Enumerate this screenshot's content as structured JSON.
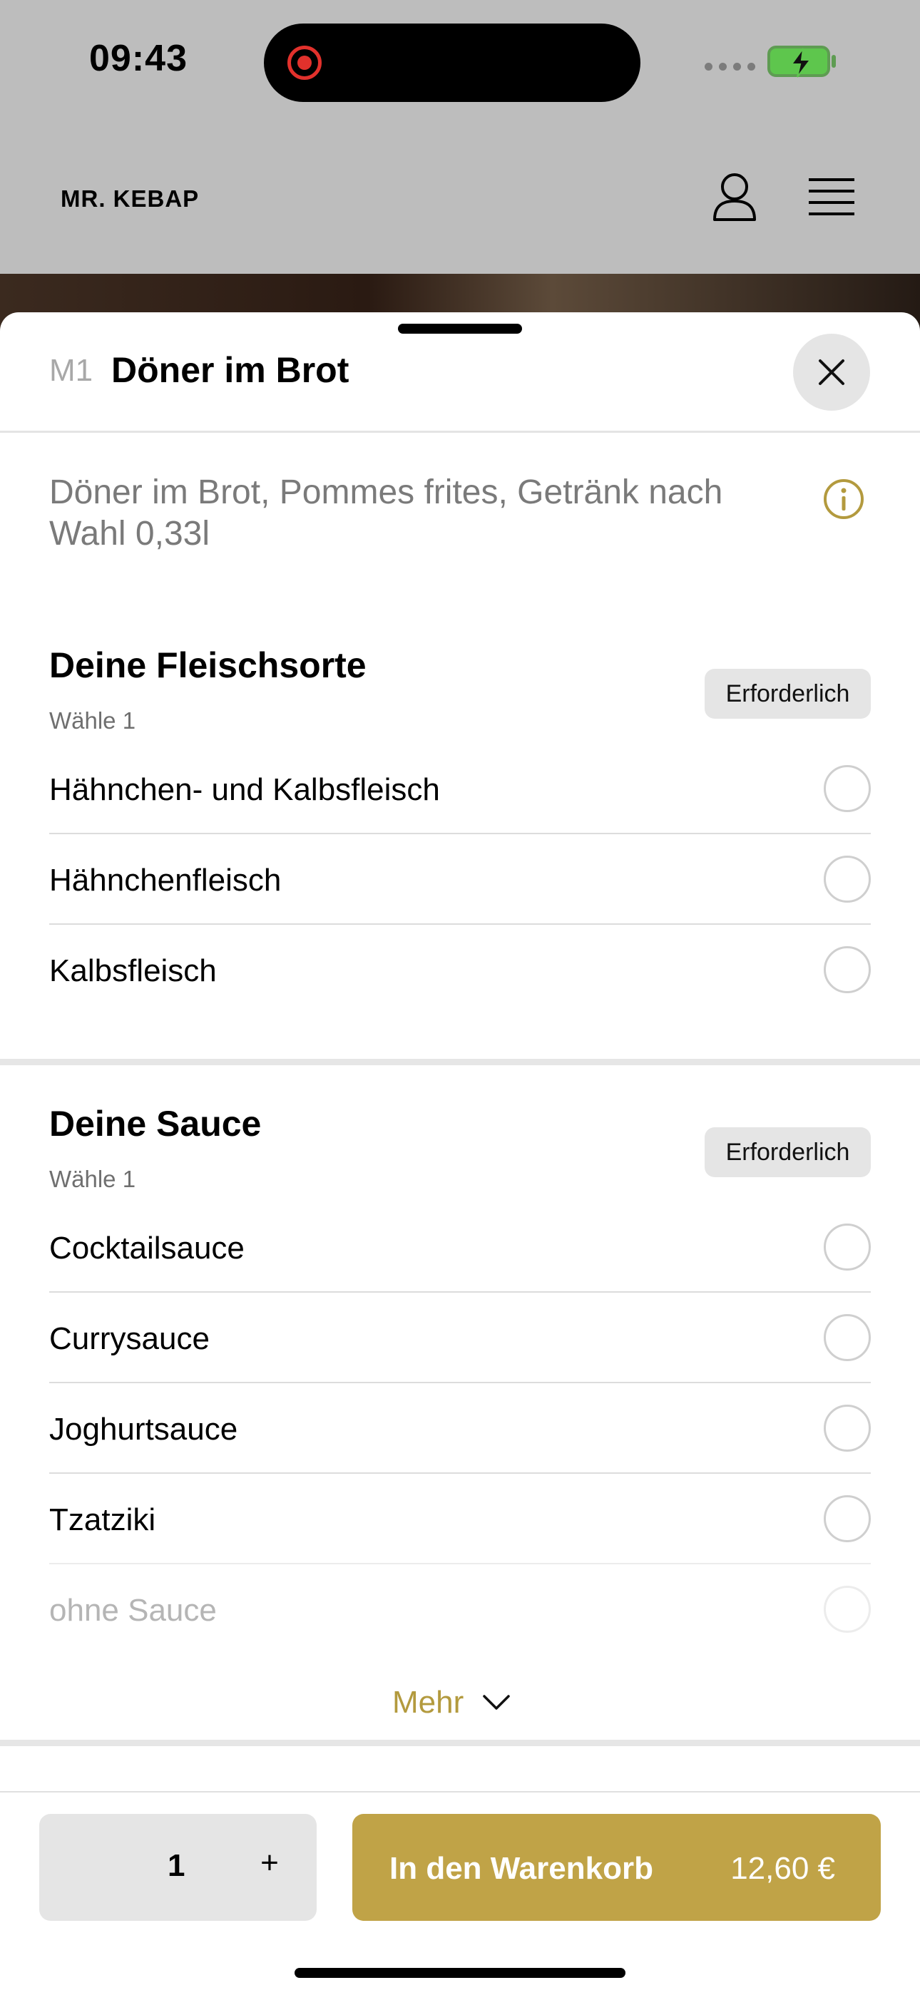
{
  "status_bar": {
    "time": "09:43"
  },
  "header": {
    "brand": "MR. KEBAP"
  },
  "sheet": {
    "code": "M1",
    "title": "Döner im Brot",
    "description": "Döner im Brot, Pommes frites, Getränk nach Wahl 0,33l"
  },
  "groups": [
    {
      "title": "Deine Fleischsorte",
      "subtitle": "Wähle 1",
      "badge": "Erforderlich",
      "options": [
        "Hähnchen- und Kalbsfleisch",
        "Hähnchenfleisch",
        "Kalbsfleisch"
      ]
    },
    {
      "title": "Deine Sauce",
      "subtitle": "Wähle 1",
      "badge": "Erforderlich",
      "options": [
        "Cocktailsauce",
        "Currysauce",
        "Joghurtsauce",
        "Tzatziki",
        "ohne Sauce"
      ]
    }
  ],
  "more_label": "Mehr",
  "footer": {
    "quantity": "1",
    "plus_symbol": "+",
    "cart_label": "In den Warenkorb",
    "price": "12,60 €"
  },
  "colors": {
    "accent": "#c0a347",
    "accent_text": "#b39a3e",
    "record": "#e2312c",
    "battery": "#5ec64d"
  },
  "icons": [
    "record-icon",
    "battery-icon",
    "user-icon",
    "menu-icon",
    "close-icon",
    "info-icon",
    "chevron-down-icon"
  ]
}
